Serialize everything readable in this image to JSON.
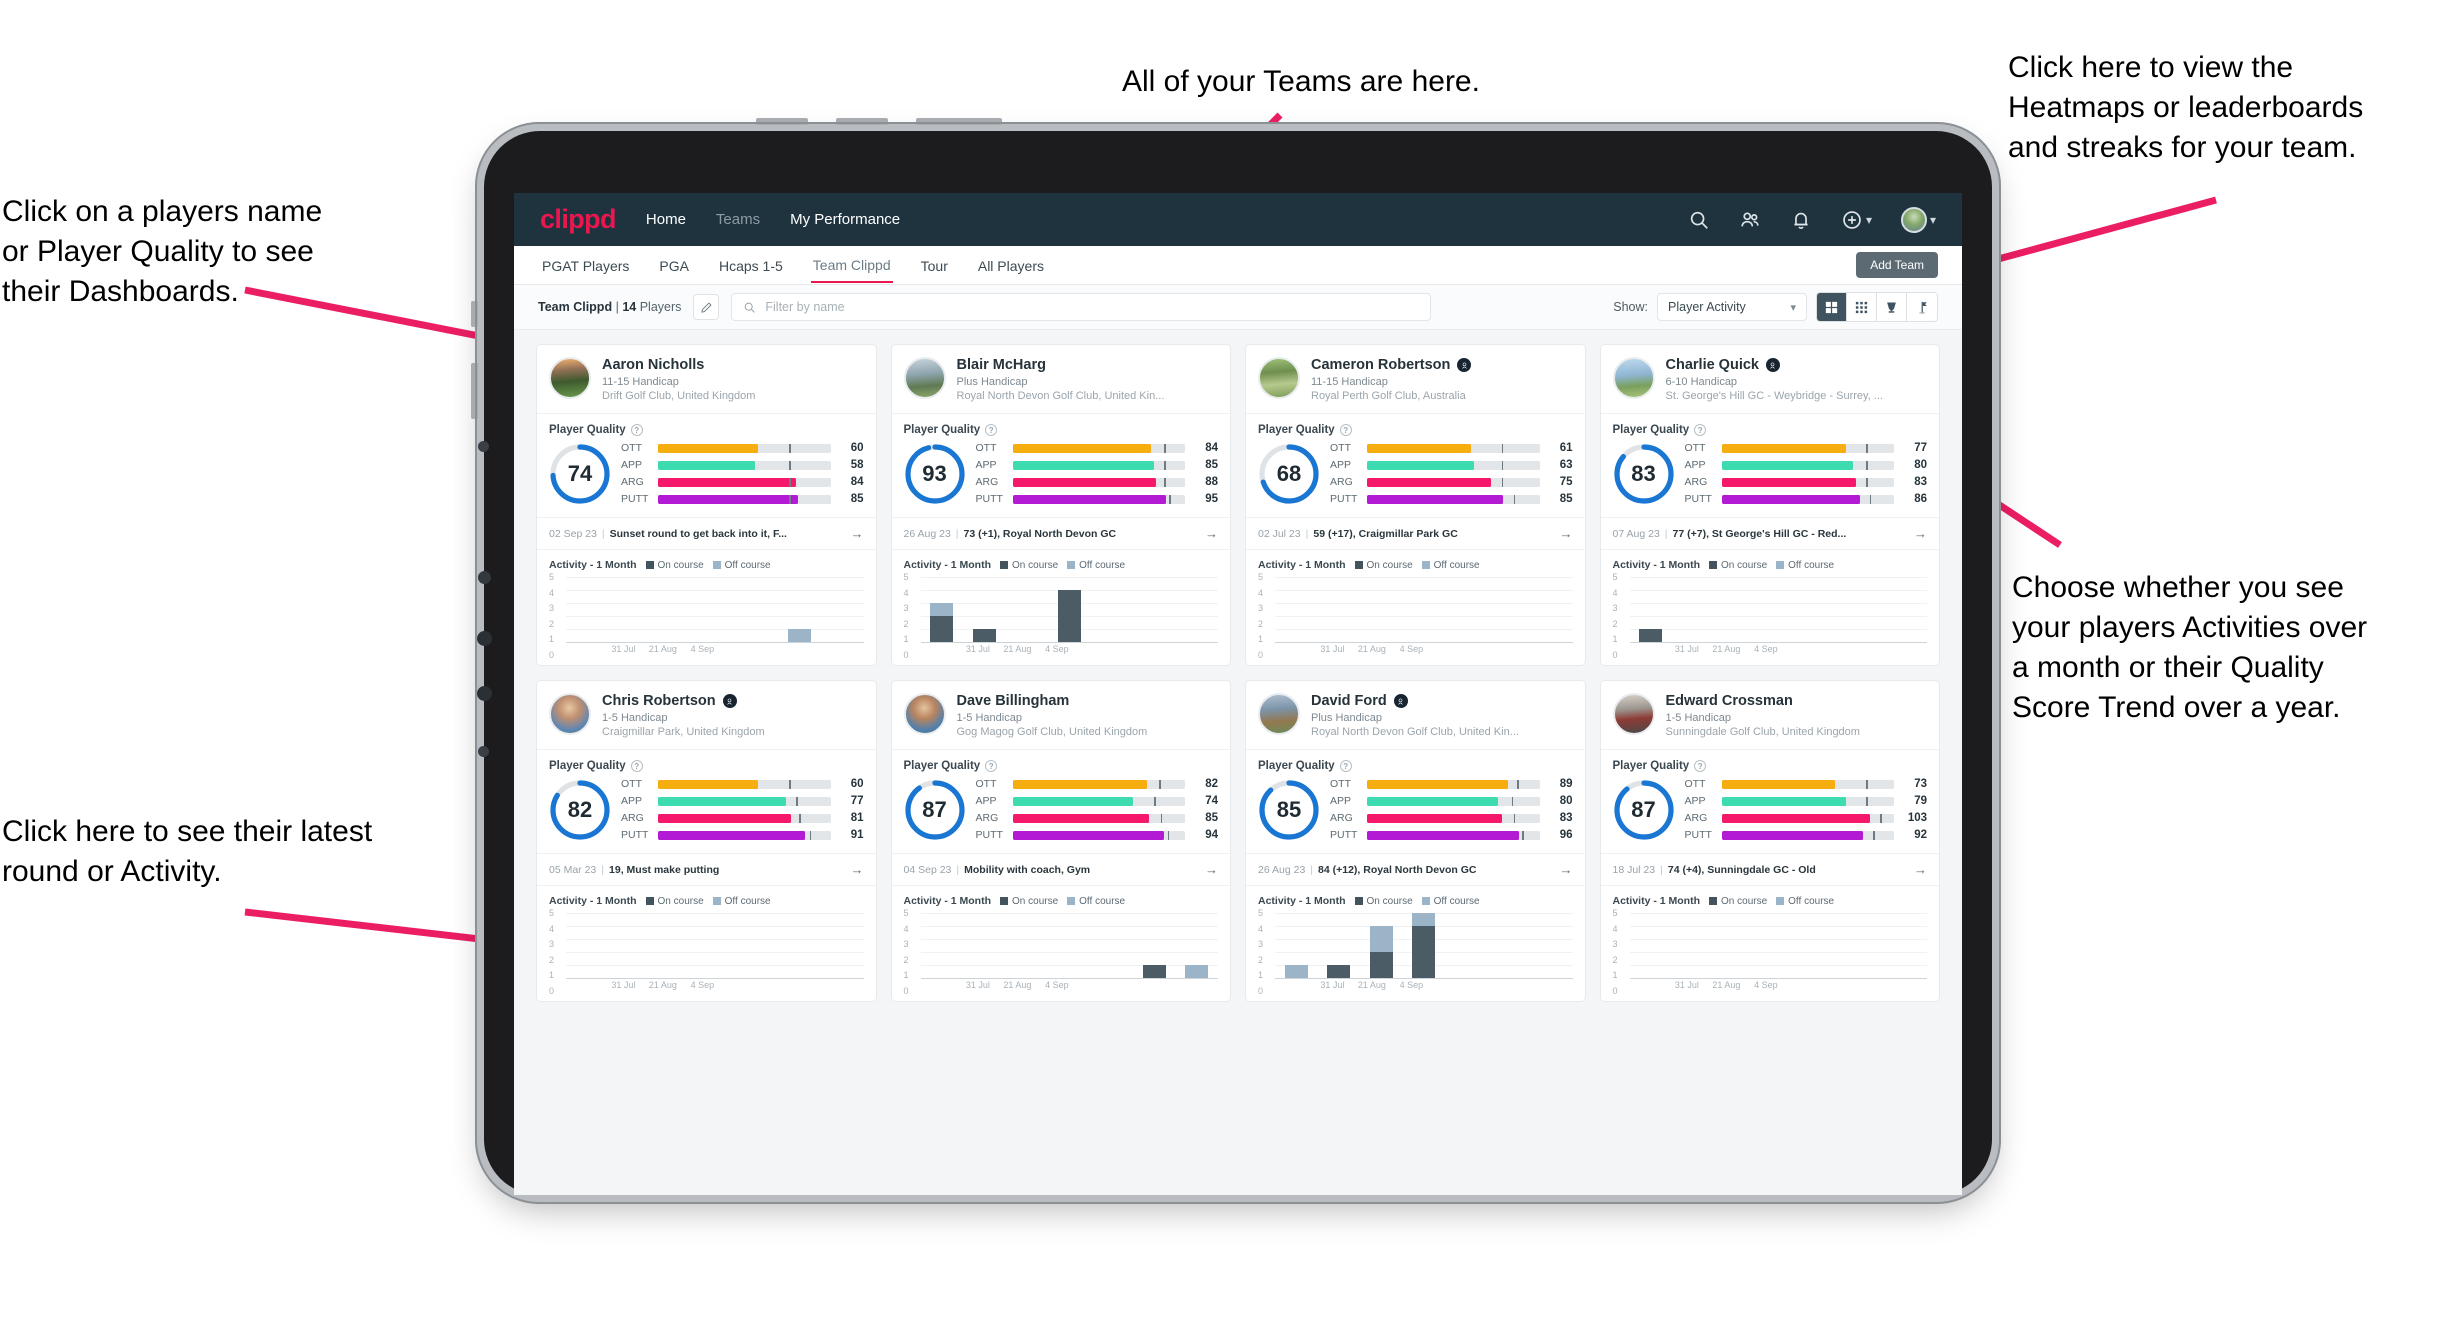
{
  "annotations": [
    {
      "id": "a-teams",
      "text": "All of your Teams are here."
    },
    {
      "id": "a-heatmaps",
      "text": "Click here to view the\nHeatmaps or leaderboards\nand streaks for your team."
    },
    {
      "id": "a-names",
      "text": "Click on a players name\nor Player Quality to see\ntheir Dashboards."
    },
    {
      "id": "a-choose",
      "text": "Choose whether you see\nyour players Activities over\na month or their Quality\nScore Trend over a year."
    },
    {
      "id": "a-latest",
      "text": "Click here to see their latest\nround or Activity."
    }
  ],
  "app": {
    "brand": "clippd",
    "brand_color": "#e8174f",
    "nav": [
      {
        "label": "Home",
        "active": true
      },
      {
        "label": "Teams",
        "active": false
      },
      {
        "label": "My Performance",
        "active": true
      }
    ],
    "nav_icons": [
      {
        "name": "search-icon"
      },
      {
        "name": "people-icon"
      },
      {
        "name": "bell-icon"
      },
      {
        "name": "plus-circle-icon"
      },
      {
        "name": "avatar-icon"
      }
    ],
    "subtabs": [
      {
        "label": "PGAT Players",
        "state": "normal"
      },
      {
        "label": "PGA",
        "state": "normal"
      },
      {
        "label": "Hcaps 1-5",
        "state": "normal"
      },
      {
        "label": "Team Clippd",
        "state": "active"
      },
      {
        "label": "Tour",
        "state": "normal"
      },
      {
        "label": "All Players",
        "state": "normal"
      }
    ],
    "add_team_label": "Add Team"
  },
  "toolbar": {
    "team_name": "Team Clippd",
    "team_separator": "|",
    "team_count": "14",
    "team_count_suffix": "Players",
    "edit_icon": "pencil-icon",
    "search_placeholder": "Filter by name",
    "show_label": "Show:",
    "show_value": "Player Activity",
    "view_modes": [
      {
        "name": "grid-large-icon",
        "active": true
      },
      {
        "name": "grid-small-icon",
        "active": false
      },
      {
        "name": "trophy-icon",
        "active": false
      },
      {
        "name": "flag-icon",
        "active": false
      }
    ]
  },
  "chart_data": {
    "type": "bar",
    "title": "Activity - 1 Month",
    "legend": [
      "On course",
      "Off course"
    ],
    "legend_position": "top-right",
    "ylim": [
      0,
      5
    ],
    "yticks": [
      0,
      1,
      2,
      3,
      4,
      5
    ],
    "xticks": [
      "31 Jul",
      "21 Aug",
      "4 Sep"
    ],
    "grid": true,
    "series_colors": {
      "on_course": "#4c5c66",
      "off_course": "#9cb4c8"
    }
  },
  "players": [
    {
      "name": "Aaron Nicholls",
      "verified": false,
      "handicap": "11-15 Handicap",
      "club": "Drift Golf Club, United Kingdom",
      "avatar_class": "av-a",
      "quality_title": "Player Quality",
      "score": 74,
      "ring_pct": 74,
      "metrics": [
        {
          "key": "OTT",
          "value": 60,
          "fill": 58,
          "tick": 76,
          "color": "#f6ad0f"
        },
        {
          "key": "APP",
          "value": 58,
          "fill": 56,
          "tick": 76,
          "color": "#3ddbb0"
        },
        {
          "key": "ARG",
          "value": 84,
          "fill": 80,
          "tick": 76,
          "color": "#f5186b"
        },
        {
          "key": "PUTT",
          "value": 85,
          "fill": 81,
          "tick": 76,
          "color": "#b21ad4"
        }
      ],
      "latest_date": "02 Sep 23",
      "latest_text": "Sunset round to get back into it, F...",
      "activity": [
        {
          "on": 0,
          "off": 0
        },
        {
          "on": 0,
          "off": 0
        },
        {
          "on": 0,
          "off": 0
        },
        {
          "on": 0,
          "off": 0
        },
        {
          "on": 0,
          "off": 0
        },
        {
          "on": 0,
          "off": 1
        },
        {
          "on": 0,
          "off": 0
        }
      ]
    },
    {
      "name": "Blair McHarg",
      "verified": false,
      "handicap": "Plus Handicap",
      "club": "Royal North Devon Golf Club, United Kin...",
      "avatar_class": "av-b",
      "quality_title": "Player Quality",
      "score": 93,
      "ring_pct": 96,
      "metrics": [
        {
          "key": "OTT",
          "value": 84,
          "fill": 80,
          "tick": 88,
          "color": "#f6ad0f"
        },
        {
          "key": "APP",
          "value": 85,
          "fill": 82,
          "tick": 88,
          "color": "#3ddbb0"
        },
        {
          "key": "ARG",
          "value": 88,
          "fill": 83,
          "tick": 88,
          "color": "#f5186b"
        },
        {
          "key": "PUTT",
          "value": 95,
          "fill": 89,
          "tick": 91,
          "color": "#b21ad4"
        }
      ],
      "latest_date": "26 Aug 23",
      "latest_text": "73 (+1), Royal North Devon GC",
      "activity": [
        {
          "on": 2,
          "off": 1
        },
        {
          "on": 1,
          "off": 0
        },
        {
          "on": 0,
          "off": 0
        },
        {
          "on": 4,
          "off": 0
        },
        {
          "on": 0,
          "off": 0
        },
        {
          "on": 0,
          "off": 0
        },
        {
          "on": 0,
          "off": 0
        }
      ]
    },
    {
      "name": "Cameron Robertson",
      "verified": true,
      "handicap": "11-15 Handicap",
      "club": "Royal Perth Golf Club, Australia",
      "avatar_class": "av-c",
      "quality_title": "Player Quality",
      "score": 68,
      "ring_pct": 70,
      "metrics": [
        {
          "key": "OTT",
          "value": 61,
          "fill": 60,
          "tick": 78,
          "color": "#f6ad0f"
        },
        {
          "key": "APP",
          "value": 63,
          "fill": 62,
          "tick": 78,
          "color": "#3ddbb0"
        },
        {
          "key": "ARG",
          "value": 75,
          "fill": 72,
          "tick": 78,
          "color": "#f5186b"
        },
        {
          "key": "PUTT",
          "value": 85,
          "fill": 79,
          "tick": 85,
          "color": "#b21ad4"
        }
      ],
      "latest_date": "02 Jul 23",
      "latest_text": "59 (+17), Craigmillar Park GC",
      "activity": [
        {
          "on": 0,
          "off": 0
        },
        {
          "on": 0,
          "off": 0
        },
        {
          "on": 0,
          "off": 0
        },
        {
          "on": 0,
          "off": 0
        },
        {
          "on": 0,
          "off": 0
        },
        {
          "on": 0,
          "off": 0
        },
        {
          "on": 0,
          "off": 0
        }
      ]
    },
    {
      "name": "Charlie Quick",
      "verified": true,
      "handicap": "6-10 Handicap",
      "club": "St. George's Hill GC - Weybridge - Surrey, ...",
      "avatar_class": "av-d",
      "quality_title": "Player Quality",
      "score": 83,
      "ring_pct": 86,
      "metrics": [
        {
          "key": "OTT",
          "value": 77,
          "fill": 72,
          "tick": 84,
          "color": "#f6ad0f"
        },
        {
          "key": "APP",
          "value": 80,
          "fill": 76,
          "tick": 84,
          "color": "#3ddbb0"
        },
        {
          "key": "ARG",
          "value": 83,
          "fill": 78,
          "tick": 84,
          "color": "#f5186b"
        },
        {
          "key": "PUTT",
          "value": 86,
          "fill": 80,
          "tick": 86,
          "color": "#b21ad4"
        }
      ],
      "latest_date": "07 Aug 23",
      "latest_text": "77 (+7), St George's Hill GC - Red...",
      "activity": [
        {
          "on": 1,
          "off": 0
        },
        {
          "on": 0,
          "off": 0
        },
        {
          "on": 0,
          "off": 0
        },
        {
          "on": 0,
          "off": 0
        },
        {
          "on": 0,
          "off": 0
        },
        {
          "on": 0,
          "off": 0
        },
        {
          "on": 0,
          "off": 0
        }
      ]
    },
    {
      "name": "Chris Robertson",
      "verified": true,
      "handicap": "1-5 Handicap",
      "club": "Craigmillar Park, United Kingdom",
      "avatar_class": "av-e",
      "quality_title": "Player Quality",
      "score": 82,
      "ring_pct": 84,
      "metrics": [
        {
          "key": "OTT",
          "value": 60,
          "fill": 58,
          "tick": 76,
          "color": "#f6ad0f"
        },
        {
          "key": "APP",
          "value": 77,
          "fill": 74,
          "tick": 80,
          "color": "#3ddbb0"
        },
        {
          "key": "ARG",
          "value": 81,
          "fill": 77,
          "tick": 82,
          "color": "#f5186b"
        },
        {
          "key": "PUTT",
          "value": 91,
          "fill": 85,
          "tick": 88,
          "color": "#b21ad4"
        }
      ],
      "latest_date": "05 Mar 23",
      "latest_text": "19, Must make putting",
      "activity": [
        {
          "on": 0,
          "off": 0
        },
        {
          "on": 0,
          "off": 0
        },
        {
          "on": 0,
          "off": 0
        },
        {
          "on": 0,
          "off": 0
        },
        {
          "on": 0,
          "off": 0
        },
        {
          "on": 0,
          "off": 0
        },
        {
          "on": 0,
          "off": 0
        }
      ]
    },
    {
      "name": "Dave Billingham",
      "verified": false,
      "handicap": "1-5 Handicap",
      "club": "Gog Magog Golf Club, United Kingdom",
      "avatar_class": "av-f",
      "quality_title": "Player Quality",
      "score": 87,
      "ring_pct": 90,
      "metrics": [
        {
          "key": "OTT",
          "value": 82,
          "fill": 78,
          "tick": 85,
          "color": "#f6ad0f"
        },
        {
          "key": "APP",
          "value": 74,
          "fill": 70,
          "tick": 82,
          "color": "#3ddbb0"
        },
        {
          "key": "ARG",
          "value": 85,
          "fill": 79,
          "tick": 86,
          "color": "#f5186b"
        },
        {
          "key": "PUTT",
          "value": 94,
          "fill": 88,
          "tick": 90,
          "color": "#b21ad4"
        }
      ],
      "latest_date": "04 Sep 23",
      "latest_text": "Mobility with coach, Gym",
      "activity": [
        {
          "on": 0,
          "off": 0
        },
        {
          "on": 0,
          "off": 0
        },
        {
          "on": 0,
          "off": 0
        },
        {
          "on": 0,
          "off": 0
        },
        {
          "on": 0,
          "off": 0
        },
        {
          "on": 1,
          "off": 0
        },
        {
          "on": 0,
          "off": 1
        }
      ]
    },
    {
      "name": "David Ford",
      "verified": true,
      "handicap": "Plus Handicap",
      "club": "Royal North Devon Golf Club, United Kin...",
      "avatar_class": "av-g",
      "quality_title": "Player Quality",
      "score": 85,
      "ring_pct": 88,
      "metrics": [
        {
          "key": "OTT",
          "value": 89,
          "fill": 82,
          "tick": 87,
          "color": "#f6ad0f"
        },
        {
          "key": "APP",
          "value": 80,
          "fill": 76,
          "tick": 84,
          "color": "#3ddbb0"
        },
        {
          "key": "ARG",
          "value": 83,
          "fill": 78,
          "tick": 85,
          "color": "#f5186b"
        },
        {
          "key": "PUTT",
          "value": 96,
          "fill": 88,
          "tick": 90,
          "color": "#b21ad4"
        }
      ],
      "latest_date": "26 Aug 23",
      "latest_text": "84 (+12), Royal North Devon GC",
      "activity": [
        {
          "on": 0,
          "off": 1
        },
        {
          "on": 1,
          "off": 0
        },
        {
          "on": 2,
          "off": 2
        },
        {
          "on": 4,
          "off": 1
        },
        {
          "on": 0,
          "off": 0
        },
        {
          "on": 0,
          "off": 0
        },
        {
          "on": 0,
          "off": 0
        }
      ]
    },
    {
      "name": "Edward Crossman",
      "verified": false,
      "handicap": "1-5 Handicap",
      "club": "Sunningdale Golf Club, United Kingdom",
      "avatar_class": "av-h",
      "quality_title": "Player Quality",
      "score": 87,
      "ring_pct": 89,
      "metrics": [
        {
          "key": "OTT",
          "value": 73,
          "fill": 66,
          "tick": 84,
          "color": "#f6ad0f"
        },
        {
          "key": "APP",
          "value": 79,
          "fill": 72,
          "tick": 84,
          "color": "#3ddbb0"
        },
        {
          "key": "ARG",
          "value": 103,
          "fill": 86,
          "tick": 92,
          "color": "#f5186b"
        },
        {
          "key": "PUTT",
          "value": 92,
          "fill": 82,
          "tick": 88,
          "color": "#b21ad4"
        }
      ],
      "latest_date": "18 Jul 23",
      "latest_text": "74 (+4), Sunningdale GC - Old",
      "activity": [
        {
          "on": 0,
          "off": 0
        },
        {
          "on": 0,
          "off": 0
        },
        {
          "on": 0,
          "off": 0
        },
        {
          "on": 0,
          "off": 0
        },
        {
          "on": 0,
          "off": 0
        },
        {
          "on": 0,
          "off": 0
        },
        {
          "on": 0,
          "off": 0
        }
      ]
    }
  ]
}
